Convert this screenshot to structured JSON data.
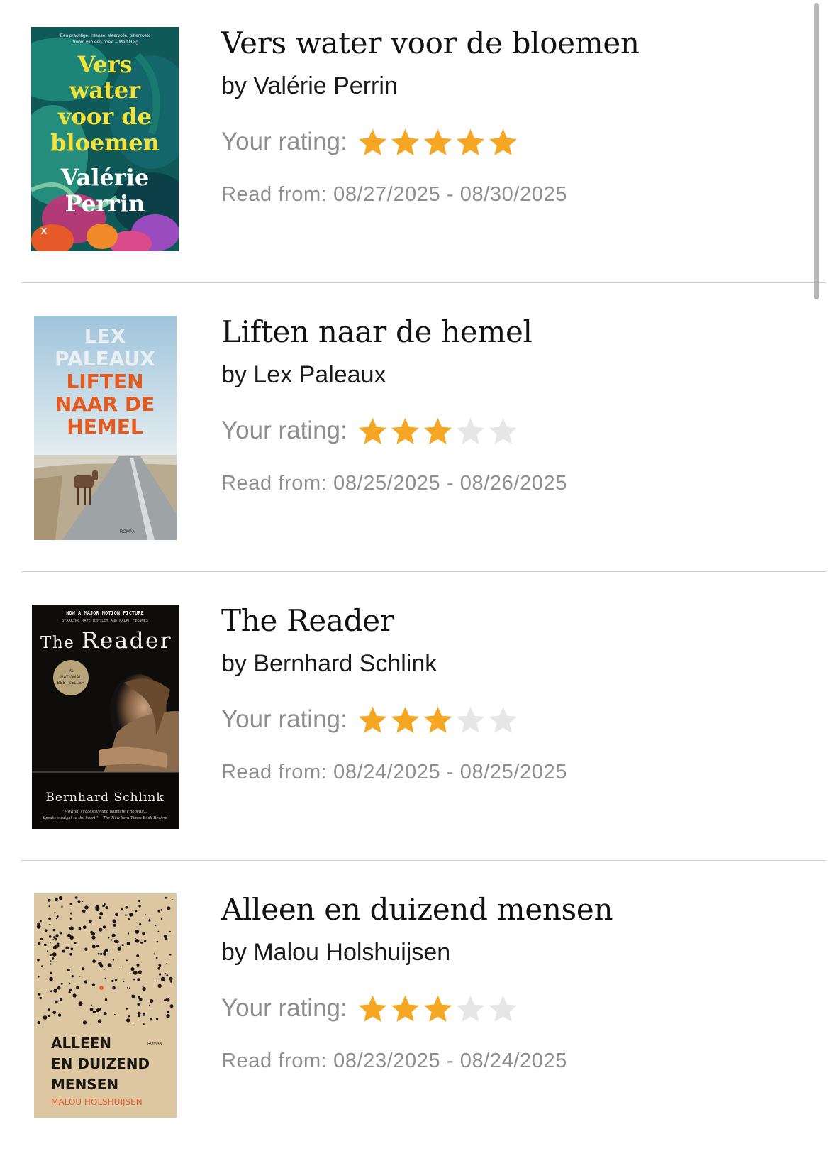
{
  "books": [
    {
      "title": "Vers water voor de bloemen",
      "author": "by Valérie Perrin",
      "rating_label": "Your rating:",
      "rating": 5,
      "max_rating": 5,
      "read_dates": "Read from: 08/27/2025 - 08/30/2025",
      "cover": {
        "quote_line1": "'Een prachtige, intense, sfeervolle, bitterzoete",
        "quote_line2": "droom van een boek' – Matt Haig",
        "title_line1": "Vers",
        "title_line2": "water",
        "title_line3": "voor de",
        "title_line4": "bloemen",
        "author_line1": "Valérie",
        "author_line2": "Perrin",
        "publisher_mark": "X"
      }
    },
    {
      "title": "Liften naar de hemel",
      "author": "by Lex Paleaux",
      "rating_label": "Your rating:",
      "rating": 3,
      "max_rating": 5,
      "read_dates": "Read from: 08/25/2025 - 08/26/2025",
      "cover": {
        "author_line1": "LEX",
        "author_line2": "PALEAUX",
        "title_line1": "LIFTEN",
        "title_line2": "NAAR DE",
        "title_line3": "HEMEL",
        "genre": "ROMAN"
      }
    },
    {
      "title": "The Reader",
      "author": "by Bernhard Schlink",
      "rating_label": "Your rating:",
      "rating": 3,
      "max_rating": 5,
      "read_dates": "Read from: 08/24/2025 - 08/25/2025",
      "cover": {
        "tagline1": "NOW A MAJOR MOTION PICTURE",
        "tagline2": "STARRING KATE WINSLET AND RALPH FIENNES",
        "title_the": "The",
        "title_reader": "Reader",
        "badge_line1": "#1",
        "badge_line2": "NATIONAL",
        "badge_line3": "BESTSELLER",
        "author": "Bernhard Schlink",
        "quote_line1": "\"Moving, suggestive and ultimately hopeful...",
        "quote_line2": "Speaks straight to the heart.\" —The New York Times Book Review"
      }
    },
    {
      "title": "Alleen en duizend mensen",
      "author": "by Malou Holshuijsen",
      "rating_label": "Your rating:",
      "rating": 3,
      "max_rating": 5,
      "read_dates": "Read from: 08/23/2025 - 08/24/2025",
      "cover": {
        "title_line1": "ALLEEN",
        "title_line2": "EN DUIZEND",
        "title_line3": "MENSEN",
        "author": "MALOU HOLSHUIJSEN",
        "genre": "ROMAN"
      }
    }
  ],
  "colors": {
    "star_filled": "#F5A623",
    "star_empty": "#E6E6E6",
    "secondary_text": "#8E8E8E",
    "divider": "#CFCFCF"
  },
  "icons": {
    "star": "star-icon"
  }
}
